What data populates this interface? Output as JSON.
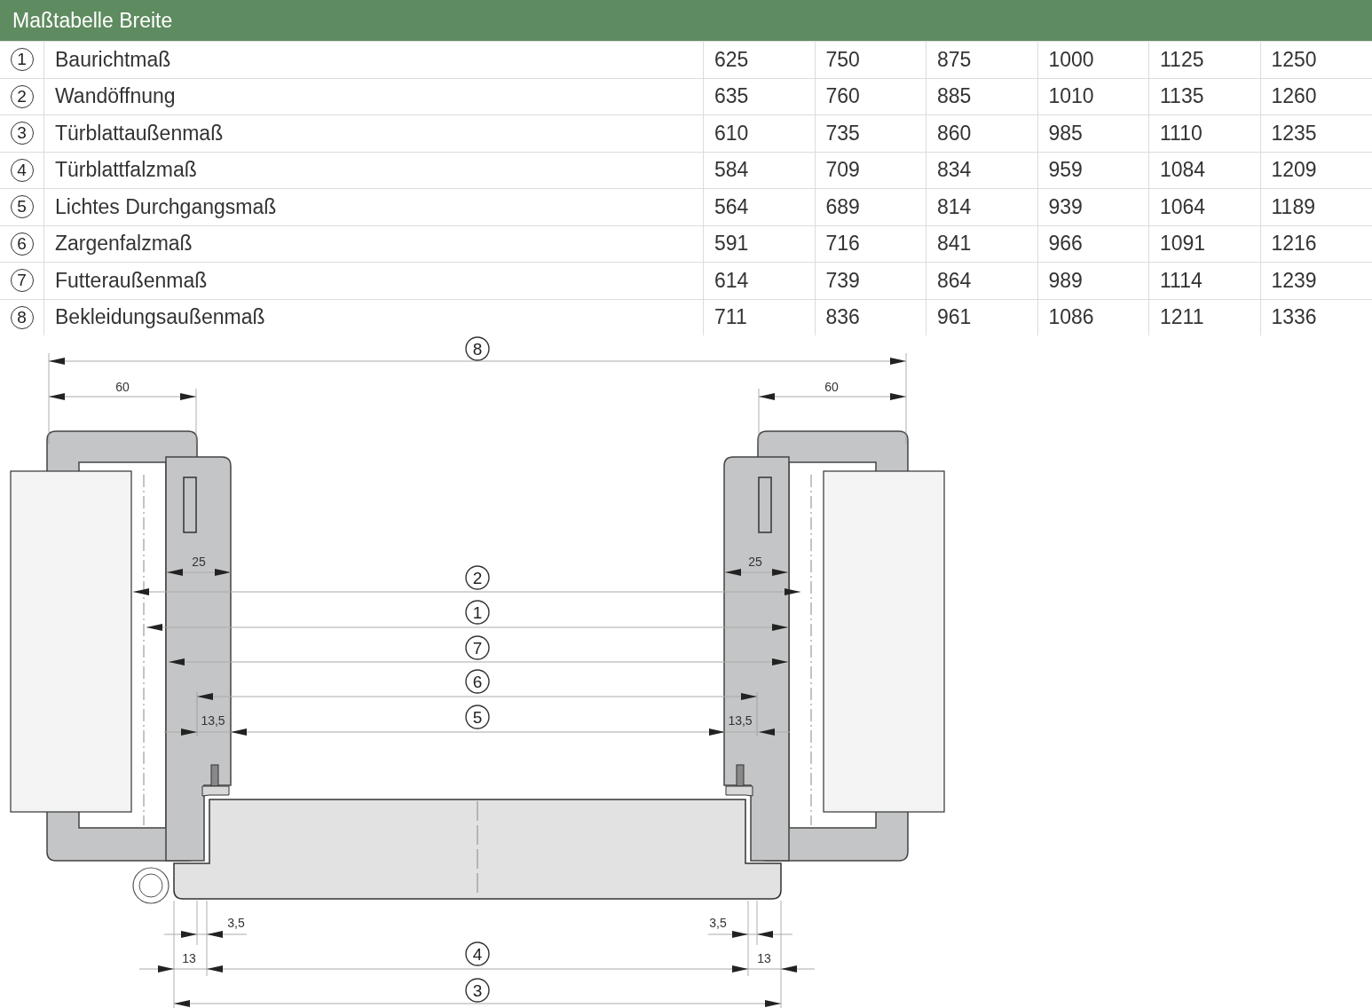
{
  "header": {
    "title": "Maßtabelle Breite"
  },
  "rows": [
    {
      "marker": "1",
      "label": "Baurichtmaß",
      "values": [
        "625",
        "750",
        "875",
        "1000",
        "1125",
        "1250"
      ]
    },
    {
      "marker": "2",
      "label": "Wandöffnung",
      "values": [
        "635",
        "760",
        "885",
        "1010",
        "1135",
        "1260"
      ]
    },
    {
      "marker": "3",
      "label": "Türblattaußenmaß",
      "values": [
        "610",
        "735",
        "860",
        "985",
        "1110",
        "1235"
      ]
    },
    {
      "marker": "4",
      "label": "Türblattfalzmaß",
      "values": [
        "584",
        "709",
        "834",
        "959",
        "1084",
        "1209"
      ]
    },
    {
      "marker": "5",
      "label": "Lichtes Durchgangsmaß",
      "values": [
        "564",
        "689",
        "814",
        "939",
        "1064",
        "1189"
      ]
    },
    {
      "marker": "6",
      "label": "Zargenfalzmaß",
      "values": [
        "591",
        "716",
        "841",
        "966",
        "1091",
        "1216"
      ]
    },
    {
      "marker": "7",
      "label": "Futteraußenmaß",
      "values": [
        "614",
        "739",
        "864",
        "989",
        "1114",
        "1239"
      ]
    },
    {
      "marker": "8",
      "label": "Bekleidungsaußenmaß",
      "values": [
        "711",
        "836",
        "961",
        "1086",
        "1211",
        "1336"
      ]
    }
  ],
  "drawing": {
    "callouts": [
      "8",
      "2",
      "1",
      "7",
      "6",
      "5",
      "4",
      "3"
    ],
    "measures": [
      "60",
      "60",
      "25",
      "25",
      "13,5",
      "13,5",
      "3,5",
      "3,5",
      "13",
      "13"
    ]
  }
}
